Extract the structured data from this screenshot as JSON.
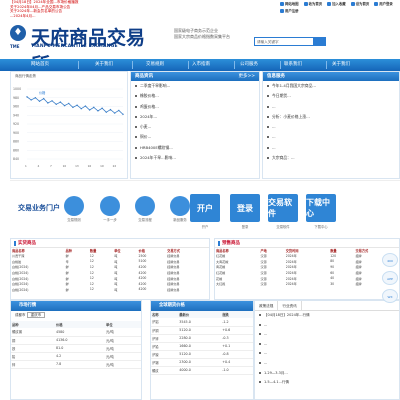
{
  "ticker": [
    "【04月18日】2024年全国...市场价格播报",
    "关于2024年04月...产品交易市场公告",
    "关于2024年...新会员名单的公告",
    "...2024年4月..."
  ],
  "top_links": [
    "网站地图",
    "收为首页",
    "加入收藏",
    "设为首页",
    "用户登录",
    "用户注册"
  ],
  "logo": {
    "name": "天府商品交易所",
    "en": "TIANFU MERCANTILE EXCHANGE",
    "abbr": "TME"
  },
  "header_desc": [
    "国家级电子商务示范企业",
    "国家大宗商品价格指数采集平台"
  ],
  "search": {
    "placeholder": "请输入关键字"
  },
  "nav": [
    "网站首页",
    "关于我们",
    "交易规则",
    "入市指南",
    "公司服务",
    "联系我们",
    "关于我们"
  ],
  "chart": {
    "title": "商品行情走势",
    "legend": "价格"
  },
  "chart_data": {
    "type": "line",
    "title": "商品行情走势",
    "x": [
      "1",
      "2",
      "3",
      "4",
      "5",
      "6",
      "7",
      "8",
      "9",
      "10",
      "11",
      "12",
      "13",
      "14",
      "15",
      "16",
      "17",
      "18",
      "19",
      "20",
      "21",
      "22",
      "23",
      "24"
    ],
    "series": [
      {
        "name": "价格",
        "values": [
          982,
          975,
          980,
          972,
          978,
          968,
          973,
          965,
          970,
          962,
          967,
          958,
          963,
          955,
          961,
          952,
          958,
          950,
          956,
          947,
          953,
          945,
          951,
          942
        ]
      }
    ],
    "ylim": [
      840,
      1000
    ],
    "yticks": [
      1000,
      980,
      960,
      940,
      920,
      900,
      880,
      860,
      840
    ]
  },
  "news": {
    "title": "商品资讯",
    "tab": "交易资讯",
    "more": "更多>>",
    "items": [
      "二季度干旱影响...",
      "橡胶价格...",
      "鸡蛋价格...",
      "2024年...",
      "小麦...",
      "铜价...",
      "HRB400E螺纹钢...",
      "2024年干旱...影响..."
    ]
  },
  "info": {
    "title": "信息服务",
    "tab": "会员服务",
    "items": [
      "今年1-4月我国大宗商品...",
      "今日期货...",
      "...",
      "分析：小麦价格上涨...",
      "...",
      "...",
      "...",
      "大宗商品：..."
    ]
  },
  "portal": {
    "title": "交易业务门户",
    "items": [
      "交易规则",
      "一手一步",
      "交易流程",
      "新品服务",
      "开户",
      "登录",
      "交易软件",
      "下载中心"
    ]
  },
  "goods": {
    "title": "实货商品",
    "cols": [
      "商品名称",
      "品种",
      "数量",
      "单位",
      "价格",
      "交易方式"
    ],
    "rows": [
      [
        "川贡干辣",
        "鲜",
        "12",
        "吨",
        "2500",
        "挂牌交易"
      ],
      [
        "白桃胶",
        "辛",
        "12",
        "吨",
        "5100",
        "挂牌交易"
      ],
      [
        "白桃(2024)",
        "鲜",
        "12",
        "吨",
        "4200",
        "挂牌交易"
      ],
      [
        "白桃(2024)",
        "鲜",
        "12",
        "吨",
        "4200",
        "挂牌交易"
      ],
      [
        "白桃(2024)",
        "鲜",
        "12",
        "吨",
        "4200",
        "挂牌交易"
      ],
      [
        "白桃(2024)",
        "鲜",
        "12",
        "吨",
        "4200",
        "挂牌交易"
      ],
      [
        "白桃(2024)",
        "鲜",
        "12",
        "吨",
        "4200",
        "挂牌交易"
      ]
    ]
  },
  "preorder": {
    "title": "预售商品",
    "cols": [
      "商品名称",
      "产地",
      "交货时间",
      "数量",
      "交易方式"
    ],
    "rows": [
      [
        "红花椒",
        "汉源",
        "2024年",
        "120",
        "挂牌"
      ],
      [
        "大青花椒",
        "汉源",
        "2024年",
        "80",
        "挂牌"
      ],
      [
        "青花椒",
        "汉源",
        "2024年",
        "90",
        "挂牌"
      ],
      [
        "红花椒",
        "汉源",
        "2024年",
        "60",
        "挂牌"
      ],
      [
        "花椒",
        "汉源",
        "2024年",
        "40",
        "挂牌"
      ],
      [
        "大红袍",
        "汉源",
        "2024年",
        "30",
        "挂牌"
      ]
    ]
  },
  "market": {
    "title": "市场行情",
    "filter": "成都市",
    "select": "重庆市",
    "cols": [
      "品种",
      "价格",
      "单位"
    ],
    "rows": [
      [
        "螺纹钢",
        "4580",
        "元/吨"
      ],
      [
        "铜",
        "4136.0",
        "元/吨"
      ],
      [
        "铁",
        "81.0",
        "元/吨"
      ],
      [
        "铅",
        "4.2",
        "元/吨"
      ],
      [
        "锌",
        "7.8",
        "元/吨"
      ]
    ]
  },
  "spot": {
    "title": "全球期货价格",
    "cols": [
      "名称",
      "最新价",
      "涨跌"
    ],
    "rows": [
      [
        "沪铝",
        "3545.0",
        "-1.2"
      ],
      [
        "沪铜",
        "5120.0",
        "+0.6"
      ],
      [
        "沪锌",
        "2280.0",
        "-0.3"
      ],
      [
        "沪铅",
        "1660.0",
        "+0.1"
      ],
      [
        "沪镍",
        "5120.0",
        "-0.8"
      ],
      [
        "沪锡",
        "2300.0",
        "+0.4"
      ],
      [
        "螺纹",
        "4000.0",
        "-1.0"
      ]
    ]
  },
  "news2": {
    "tabs": [
      "政策法规",
      "行业资讯"
    ],
    "items": [
      "【04月18日】2024年...行情",
      "...",
      "...",
      "...",
      "...",
      "...",
      "1.29—3.3月...",
      "1.5—4.1...行情"
    ]
  },
  "side": [
    "400",
    "APP",
    "WX"
  ]
}
